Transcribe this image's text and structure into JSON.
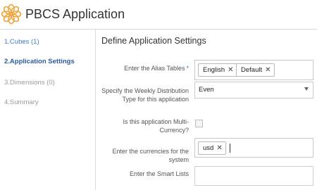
{
  "header": {
    "title": "PBCS Application",
    "logo_color": "#f2a43a"
  },
  "sidebar": {
    "steps": [
      {
        "label": "1.Cubes (1)",
        "state": "done"
      },
      {
        "label": "2.Application Settings",
        "state": "active"
      },
      {
        "label": "3.Dimensions (0)",
        "state": "pending"
      },
      {
        "label": "4.Summary",
        "state": "pending"
      }
    ]
  },
  "main": {
    "section_title": "Define Application Settings",
    "required_marker": "*",
    "alias_tables": {
      "label": "Enter the Alias Tables",
      "tags": [
        "English",
        "Default"
      ]
    },
    "distribution": {
      "label": "Specify the Weekly Distribution Type for this application",
      "value": "Even"
    },
    "multi_currency": {
      "label": "Is this application Multi-Currency?",
      "checked": false
    },
    "currencies": {
      "label": "Enter the currencies for the system",
      "tags": [
        "usd"
      ]
    },
    "smart_lists": {
      "label": "Enter the Smart Lists",
      "value": ""
    },
    "remove_glyph": "✕"
  }
}
